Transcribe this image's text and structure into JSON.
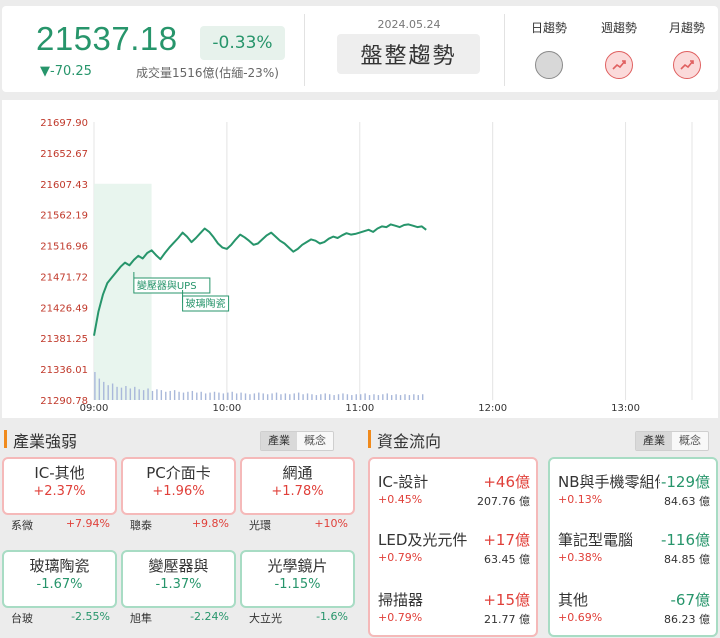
{
  "index": {
    "price": "21537.18",
    "percent": "-0.33%",
    "change": "▼-70.25",
    "volume": "成交量1516億(估緬-23%)",
    "date": "2024.05.24",
    "trend_label": "盤整趨勢"
  },
  "trends": [
    {
      "label": "日趨勢",
      "state": "neutral",
      "icon": "circle-neutral-icon"
    },
    {
      "label": "週趨勢",
      "state": "up",
      "icon": "trend-up-icon"
    },
    {
      "label": "月趨勢",
      "state": "up",
      "icon": "trend-up-icon"
    }
  ],
  "colors": {
    "up": "#e0403a",
    "down": "#27956b",
    "accent": "#f08a1c"
  },
  "chart_data": {
    "type": "line",
    "y_ticks": [
      "21697.90",
      "21652.67",
      "21607.43",
      "21562.19",
      "21516.96",
      "21471.72",
      "21426.49",
      "21381.25",
      "21336.01",
      "21290.78"
    ],
    "x_ticks": [
      "09:00",
      "10:00",
      "11:00",
      "12:00",
      "13:00"
    ],
    "ylim": [
      21290.78,
      21697.9
    ],
    "x_range_minutes": [
      0,
      270
    ],
    "series": [
      {
        "x": [
          0,
          2,
          4,
          6,
          8,
          10,
          12,
          14,
          16,
          18,
          20,
          22,
          24,
          26,
          28,
          30,
          32,
          34,
          36,
          38,
          40,
          42,
          44,
          46,
          48,
          50,
          52,
          54,
          56,
          58,
          60,
          62,
          64,
          66,
          68,
          70,
          72,
          74,
          76,
          78,
          80,
          82,
          84,
          86,
          88,
          90,
          92,
          94,
          96,
          98,
          100,
          102,
          104,
          106,
          108,
          110,
          112,
          114,
          116,
          118,
          120,
          122,
          124,
          126,
          128,
          130,
          132,
          134,
          136,
          138,
          140,
          142,
          144,
          146,
          148,
          150
        ],
        "y": [
          21385,
          21420,
          21445,
          21462,
          21470,
          21478,
          21486,
          21492,
          21488,
          21496,
          21502,
          21498,
          21506,
          21510,
          21503,
          21497,
          21506,
          21514,
          21521,
          21528,
          21536,
          21530,
          21522,
          21528,
          21535,
          21542,
          21537,
          21529,
          21520,
          21514,
          21512,
          21518,
          21526,
          21533,
          21529,
          21524,
          21518,
          21520,
          21526,
          21532,
          21536,
          21530,
          21524,
          21520,
          21514,
          21508,
          21512,
          21518,
          21522,
          21526,
          21524,
          21520,
          21522,
          21527,
          21530,
          21528,
          21532,
          21535,
          21533,
          21534,
          21536,
          21538,
          21540,
          21537,
          21542,
          21545,
          21544,
          21548,
          21546,
          21544,
          21547,
          21548,
          21546,
          21544,
          21545,
          21540
        ]
      }
    ],
    "volume_bars": [
      34,
      26,
      22,
      18,
      20,
      16,
      15,
      17,
      14,
      16,
      13,
      12,
      14,
      11,
      13,
      12,
      10,
      11,
      12,
      10,
      9,
      10,
      11,
      9,
      10,
      8,
      9,
      10,
      9,
      8,
      9,
      10,
      8,
      9,
      8,
      7,
      8,
      9,
      8,
      7,
      8,
      9,
      7,
      8,
      7,
      8,
      9,
      7,
      8,
      7,
      6,
      7,
      8,
      7,
      6,
      7,
      8,
      7,
      6,
      7,
      7,
      8,
      6,
      7,
      6,
      7,
      8,
      6,
      7,
      6,
      7,
      6,
      7,
      6,
      7
    ],
    "open_band": [
      21290.78,
      21607.43
    ],
    "annotations": [
      {
        "text": "變壓器與UPS",
        "x": 18,
        "y": 21470
      },
      {
        "text": "玻璃陶瓷",
        "x": 40,
        "y": 21433
      }
    ]
  },
  "industry": {
    "title": "產業強弱",
    "tabs": [
      "產業",
      "概念"
    ],
    "cards": [
      {
        "name": "IC-其他",
        "pct": "+2.37%",
        "dir": "up",
        "sub_name": "系微",
        "sub_pct": "+7.94%"
      },
      {
        "name": "PC介面卡",
        "pct": "+1.96%",
        "dir": "up",
        "sub_name": "聰泰",
        "sub_pct": "+9.8%"
      },
      {
        "name": "網通",
        "pct": "+1.78%",
        "dir": "up",
        "sub_name": "光環",
        "sub_pct": "+10%"
      },
      {
        "name": "玻璃陶瓷",
        "pct": "-1.67%",
        "dir": "dn",
        "sub_name": "台玻",
        "sub_pct": "-2.55%"
      },
      {
        "name": "變壓器與",
        "pct": "-1.37%",
        "dir": "dn",
        "sub_name": "旭隼",
        "sub_pct": "-2.24%"
      },
      {
        "name": "光學鏡片",
        "pct": "-1.15%",
        "dir": "dn",
        "sub_name": "大立光",
        "sub_pct": "-1.6%"
      }
    ]
  },
  "fundflow": {
    "title": "資金流向",
    "tabs": [
      "產業",
      "概念"
    ],
    "inflow": [
      {
        "name": "IC-設計",
        "amount": "+46億",
        "pct": "+0.45%",
        "total": "207.76 億"
      },
      {
        "name": "LED及光元件",
        "amount": "+17億",
        "pct": "+0.79%",
        "total": "63.45 億"
      },
      {
        "name": "掃描器",
        "amount": "+15億",
        "pct": "+0.79%",
        "total": "21.77 億"
      }
    ],
    "outflow": [
      {
        "name": "NB與手機零組件",
        "amount": "-129億",
        "pct": "+0.13%",
        "total": "84.63 億"
      },
      {
        "name": "筆記型電腦",
        "amount": "-116億",
        "pct": "+0.38%",
        "total": "84.85 億"
      },
      {
        "name": "其他",
        "amount": "-67億",
        "pct": "+0.69%",
        "total": "86.23 億"
      }
    ]
  }
}
